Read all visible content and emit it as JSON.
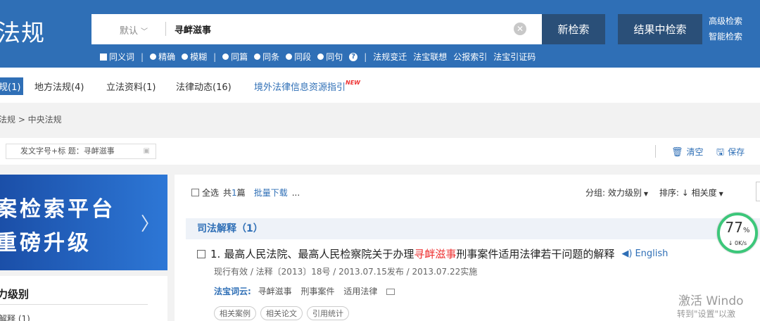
{
  "header": {
    "logo": "法规",
    "search_scope": "默认",
    "query": "寻衅滋事",
    "btn_new": "新检索",
    "btn_within": "结果中检索",
    "advanced": "高级检索",
    "smart": "智能检索",
    "options": {
      "synonym": "同义词",
      "exact": "精确",
      "fuzzy": "模糊",
      "same_article": "同篇",
      "same_clause": "同条",
      "same_para": "同段",
      "same_sentence": "同句",
      "law_change": "法规变迁",
      "fabao_link": "法宝联想",
      "gazette_index": "公报索引",
      "citation_code": "法宝引证码"
    }
  },
  "tabs": {
    "central": "规(1)",
    "local": "地方法规(4)",
    "legislative": "立法资料(1)",
    "trends": "法律动态(16)",
    "foreign": "境外法律信息资源指引",
    "new_badge": "NEW"
  },
  "breadcrumb": "法规 > 中央法规",
  "filter": {
    "chip": "发文字号+标 题：寻衅滋事",
    "clear": "清空",
    "save": "保存"
  },
  "banner": {
    "line1": "案检索平台",
    "line2": "重磅升级"
  },
  "left_panel": {
    "title": "力级别",
    "item": "解释 (1)"
  },
  "results": {
    "select_all": "全选",
    "count_prefix": "共",
    "count": "1",
    "count_suffix": "篇",
    "batch_download": "批量下载",
    "more": "...",
    "group_label": "分组: 效力级别",
    "sort_label": "排序: ↓ 相关度",
    "category": "司法解释（1）",
    "item": {
      "number": "1.",
      "title_before": "最高人民法院、最高人民检察院关于办理",
      "title_highlight": "寻衅滋事",
      "title_after": "刑事案件适用法律若干问题的解释",
      "english": "English",
      "meta": "现行有效 / 法释〔2013〕18号 / 2013.07.15发布 / 2013.07.22实施",
      "cloud_label": "法宝词云:",
      "keywords": [
        "寻衅滋事",
        "刑事案件",
        "适用法律"
      ],
      "pills": [
        "相关案例",
        "相关论文",
        "引用统计"
      ]
    }
  },
  "widgets": {
    "speed_pct": "77",
    "speed_unit": "%",
    "speed_rate": "↓ 0K/s",
    "watermark_line1": "激活 Windo",
    "watermark_line2": "转到\"设置\"以激"
  },
  "colors": {
    "brand_blue": "#2f6fb6",
    "dark_button": "#2a4f78",
    "highlight_red": "#e33333",
    "speed_green": "#3cc77a"
  }
}
